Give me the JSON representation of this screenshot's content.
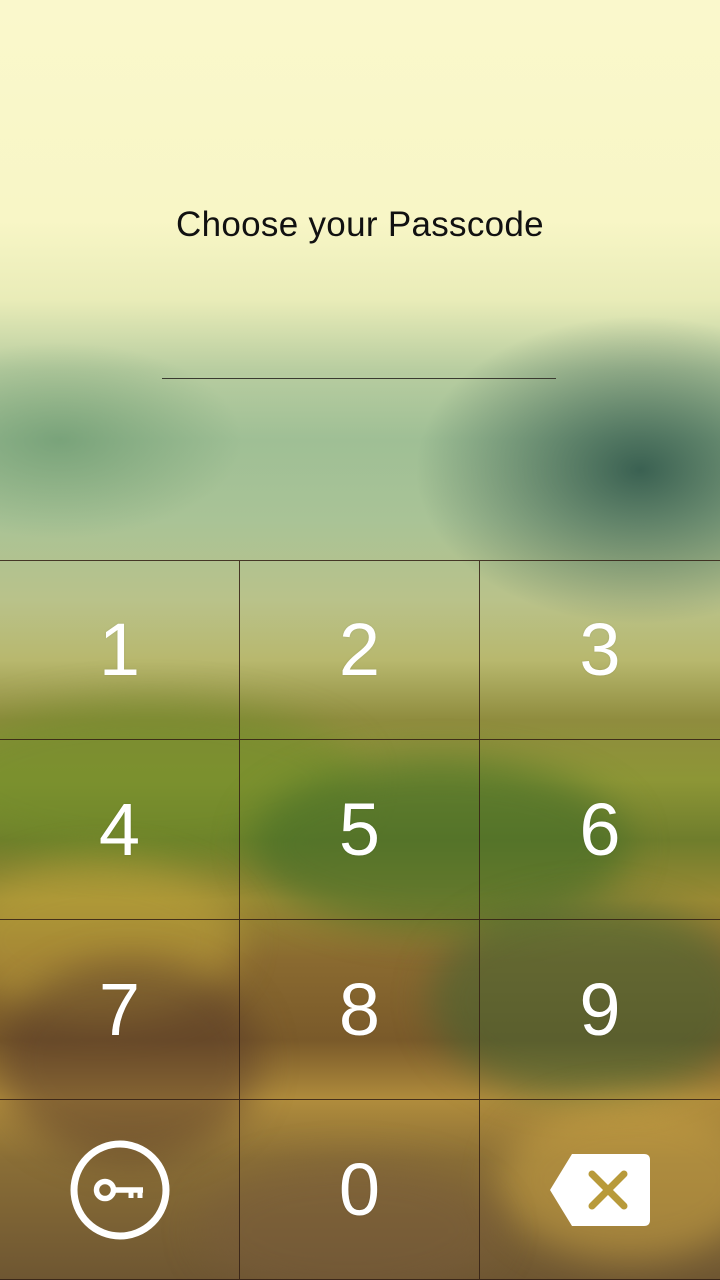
{
  "header": {
    "title": "Choose your Passcode"
  },
  "passcode": {
    "entered": ""
  },
  "keypad": {
    "keys": [
      "1",
      "2",
      "3",
      "4",
      "5",
      "6",
      "7",
      "8",
      "9",
      "0"
    ],
    "left_action_icon": "key-icon",
    "right_action_icon": "backspace-icon"
  },
  "colors": {
    "key_text": "#ffffff",
    "divider": "#32201a",
    "backspace_x": "#b89a3a"
  }
}
